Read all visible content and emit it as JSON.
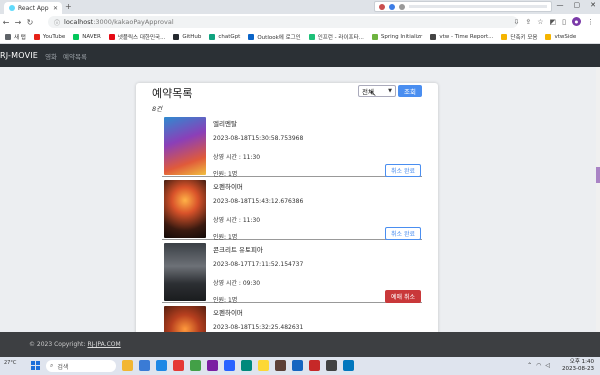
{
  "browser": {
    "tab_title": "React App",
    "url_host": "localhost",
    "url_path": ":3000/kakaoPayApproval",
    "bookmarks": [
      {
        "label": "새 탭",
        "color": "#5f6368"
      },
      {
        "label": "YouTube",
        "color": "#e62117"
      },
      {
        "label": "NAVER",
        "color": "#03c75a"
      },
      {
        "label": "넷플릭스 대한민국...",
        "color": "#e50914"
      },
      {
        "label": "GitHub",
        "color": "#24292e"
      },
      {
        "label": "chatGpt",
        "color": "#10a37f"
      },
      {
        "label": "Outlook에 로그인",
        "color": "#0a64c8"
      },
      {
        "label": "인프런 - 라이프타...",
        "color": "#1dc078"
      },
      {
        "label": "Spring Initializr",
        "color": "#6db33f"
      },
      {
        "label": "vtw - Time Report...",
        "color": "#444"
      },
      {
        "label": "단축키 모음",
        "color": "#f5b400"
      },
      {
        "label": "vtwSide",
        "color": "#f5b400"
      }
    ]
  },
  "nav": {
    "brand": "RJ-MOVIE",
    "links": [
      "영화",
      "예약목록"
    ]
  },
  "reservations": {
    "title": "예약목록",
    "count": "8건",
    "filter_value": "전체",
    "search_label": "조회",
    "items": [
      {
        "movie": "엘리멘탈",
        "date": "2023-08-18T15:30:58.753968",
        "showtime": "상영 시간 : 11:30",
        "people": "인원: 1명",
        "action": "취소 완료",
        "cancelled": true
      },
      {
        "movie": "오펜하이머",
        "date": "2023-08-18T15:43:12.676386",
        "showtime": "상영 시간 : 11:30",
        "people": "인원: 1명",
        "action": "취소 완료",
        "cancelled": true
      },
      {
        "movie": "콘크리트 유토피아",
        "date": "2023-08-17T17:11:52.154737",
        "showtime": "상영 시간 : 09:30",
        "people": "인원: 1명",
        "action": "예매 취소",
        "cancelled": false
      },
      {
        "movie": "오펜하이머",
        "date": "2023-08-18T15:32:25.482631",
        "showtime": "",
        "people": "",
        "action": "",
        "cancelled": true
      }
    ]
  },
  "footer": {
    "copyright": "© 2023 Copyright:",
    "link": "RJ-JPA.COM"
  },
  "taskbar": {
    "search_placeholder": "검색",
    "time": "오후 1:40",
    "date": "2023-08-23",
    "weather": "27°C"
  },
  "colors": {
    "accent": "#4a8ef0",
    "danger": "#c9383a",
    "navbar": "#2b3035",
    "footer": "#3d3f42"
  }
}
